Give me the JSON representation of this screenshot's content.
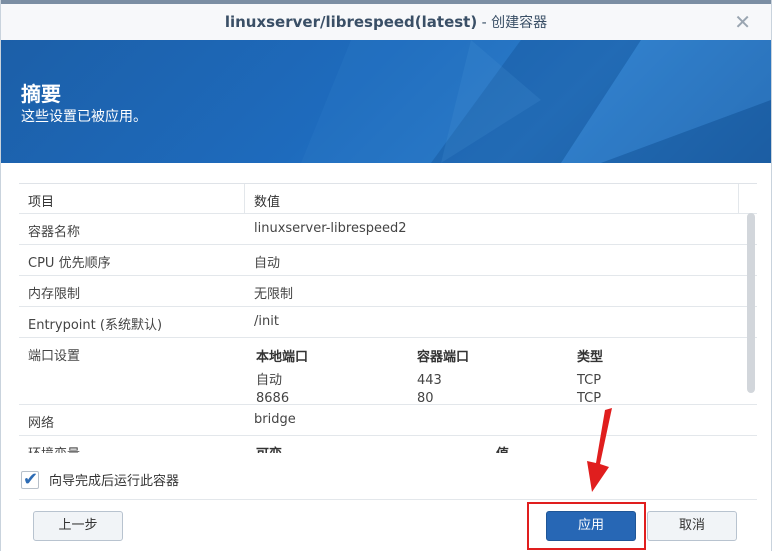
{
  "dialog": {
    "title_main": "linuxserver/librespeed(latest)",
    "title_sub": " - 创建容器",
    "close_glyph": "✕"
  },
  "banner": {
    "title": "摘要",
    "subtitle": "这些设置已被应用。"
  },
  "table": {
    "headers": [
      "项目",
      "数值"
    ],
    "rows": [
      {
        "label": "容器名称",
        "value": "linuxserver-librespeed2"
      },
      {
        "label": "CPU 优先顺序",
        "value": "自动"
      },
      {
        "label": "内存限制",
        "value": "无限制"
      },
      {
        "label": "Entrypoint (系统默认)",
        "value": "/init"
      }
    ],
    "ports": {
      "label": "端口设置",
      "headers": [
        "本地端口",
        "容器端口",
        "类型"
      ],
      "rows": [
        [
          "自动",
          "443",
          "TCP"
        ],
        [
          "8686",
          "80",
          "TCP"
        ]
      ]
    },
    "network": {
      "label": "网络",
      "value": "bridge"
    },
    "env": {
      "label": "环境变量",
      "headers": [
        "可变",
        "值"
      ]
    }
  },
  "checkbox": {
    "label": "向导完成后运行此容器",
    "checked": true
  },
  "buttons": {
    "prev": "上一步",
    "apply": "应用",
    "cancel": "取消"
  },
  "colors": {
    "accent": "#2767b5",
    "banner": "#1e6bbd",
    "highlight": "#e01e1e"
  }
}
